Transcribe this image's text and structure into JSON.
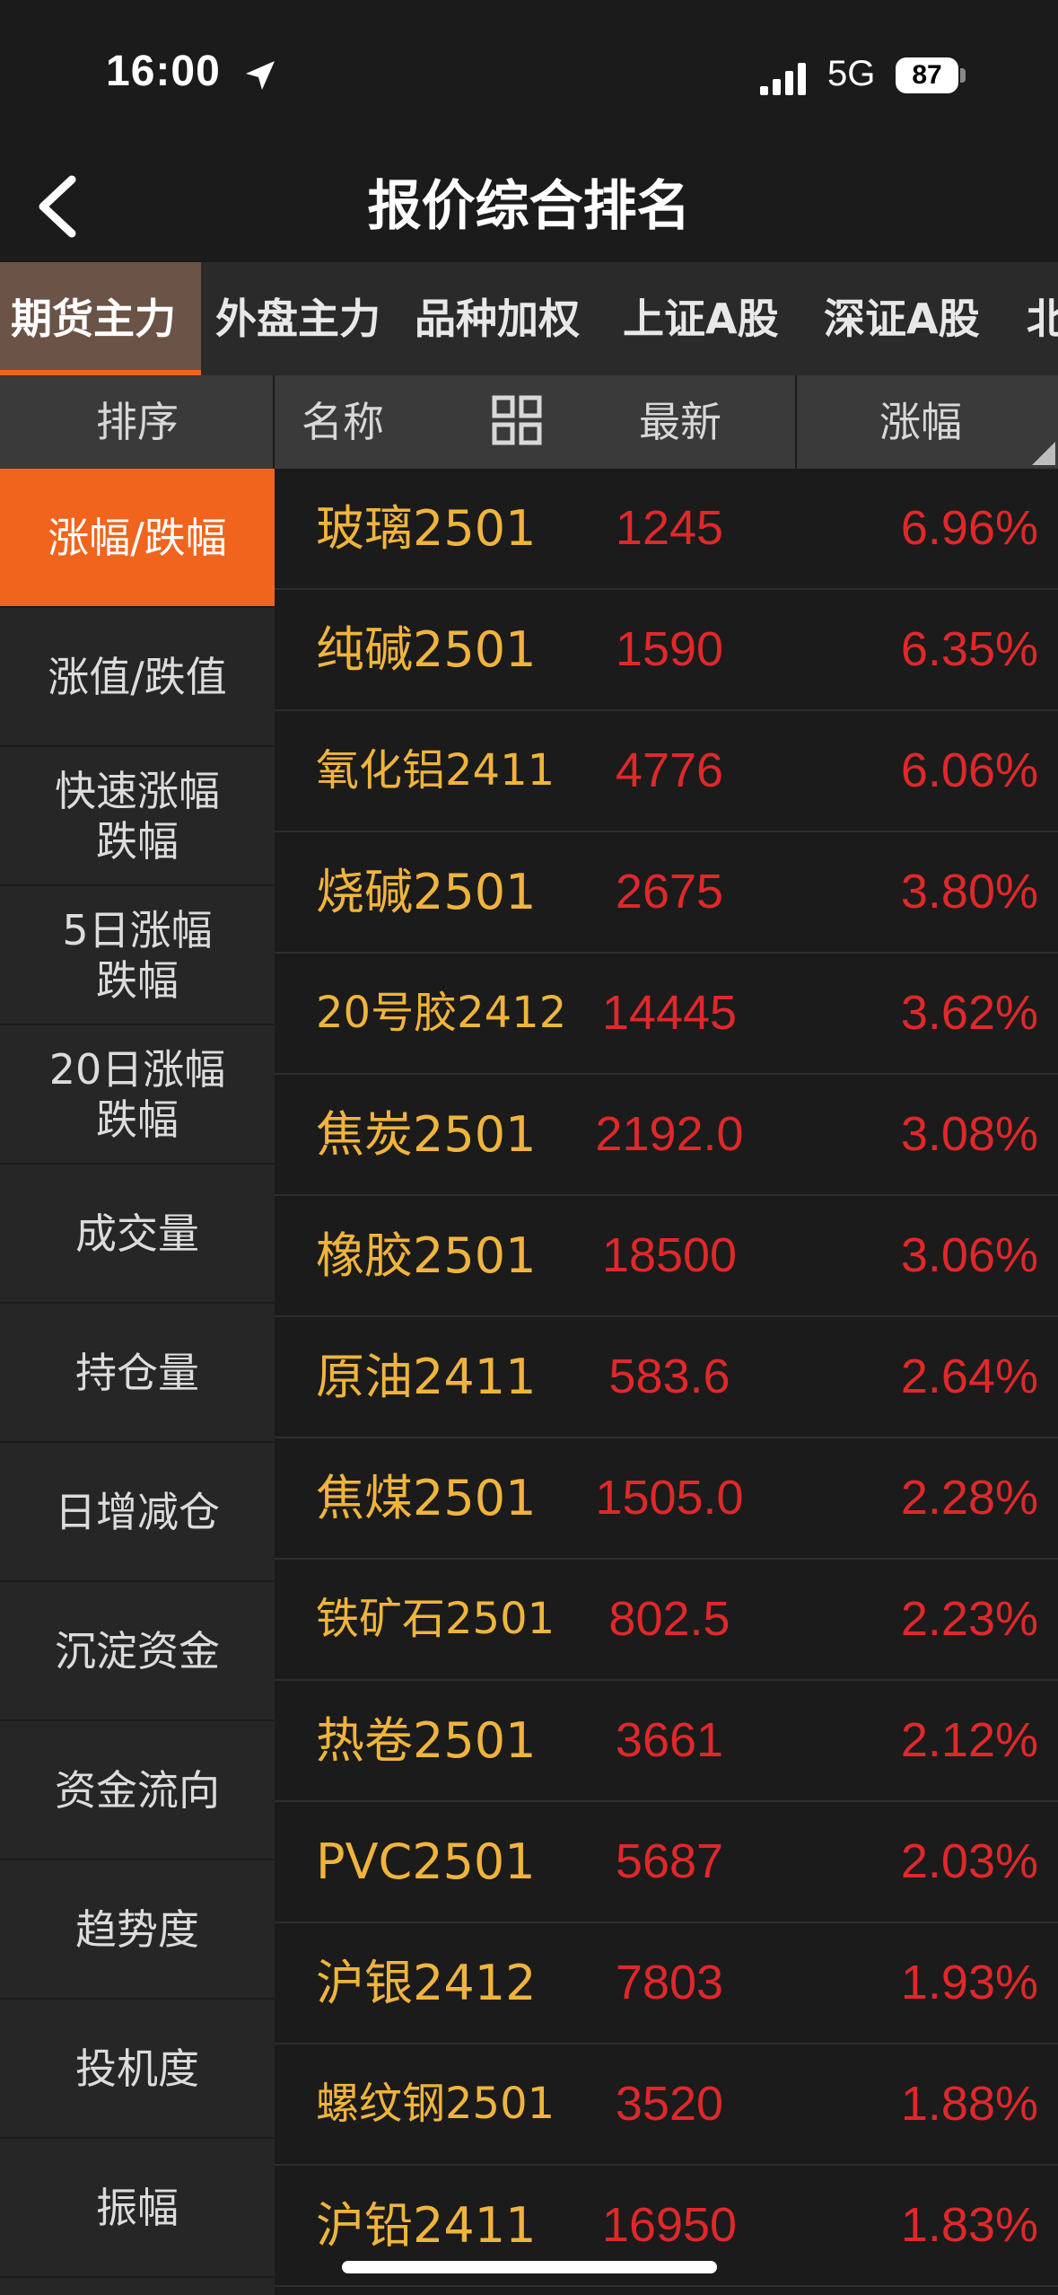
{
  "status": {
    "time": "16:00",
    "network": "5G",
    "battery": "87"
  },
  "nav": {
    "title": "报价综合排名"
  },
  "tabs": [
    "期货主力",
    "外盘主力",
    "品种加权",
    "上证A股",
    "深证A股",
    "北"
  ],
  "headers": {
    "sort": "排序",
    "name": "名称",
    "latest": "最新",
    "change": "涨幅"
  },
  "menu": [
    {
      "line1": "涨幅/跌幅",
      "line2": ""
    },
    {
      "line1": "涨值/跌值",
      "line2": ""
    },
    {
      "line1": "快速涨幅",
      "line2": "跌幅"
    },
    {
      "line1": "5日涨幅",
      "line2": "跌幅"
    },
    {
      "line1": "20日涨幅",
      "line2": "跌幅"
    },
    {
      "line1": "成交量",
      "line2": ""
    },
    {
      "line1": "持仓量",
      "line2": ""
    },
    {
      "line1": "日增减仓",
      "line2": ""
    },
    {
      "line1": "沉淀资金",
      "line2": ""
    },
    {
      "line1": "资金流向",
      "line2": ""
    },
    {
      "line1": "趋势度",
      "line2": ""
    },
    {
      "line1": "投机度",
      "line2": ""
    },
    {
      "line1": "振幅",
      "line2": ""
    }
  ],
  "rows": [
    {
      "name": "玻璃2501",
      "price": "1245",
      "change": "6.96%"
    },
    {
      "name": "纯碱2501",
      "price": "1590",
      "change": "6.35%"
    },
    {
      "name": "氧化铝2411",
      "price": "4776",
      "change": "6.06%"
    },
    {
      "name": "烧碱2501",
      "price": "2675",
      "change": "3.80%"
    },
    {
      "name": "20号胶2412",
      "price": "14445",
      "change": "3.62%"
    },
    {
      "name": "焦炭2501",
      "price": "2192.0",
      "change": "3.08%"
    },
    {
      "name": "橡胶2501",
      "price": "18500",
      "change": "3.06%"
    },
    {
      "name": "原油2411",
      "price": "583.6",
      "change": "2.64%"
    },
    {
      "name": "焦煤2501",
      "price": "1505.0",
      "change": "2.28%"
    },
    {
      "name": "铁矿石2501",
      "price": "802.5",
      "change": "2.23%"
    },
    {
      "name": "热卷2501",
      "price": "3661",
      "change": "2.12%"
    },
    {
      "name": "PVC2501",
      "price": "5687",
      "change": "2.03%"
    },
    {
      "name": "沪银2412",
      "price": "7803",
      "change": "1.93%"
    },
    {
      "name": "螺纹钢2501",
      "price": "3520",
      "change": "1.88%"
    },
    {
      "name": "沪铅2411",
      "price": "16950",
      "change": "1.83%"
    }
  ],
  "colors": {
    "accent": "#f0641e",
    "name": "#f0b43c",
    "up": "#e0282a",
    "bg": "#1b1b1b"
  }
}
